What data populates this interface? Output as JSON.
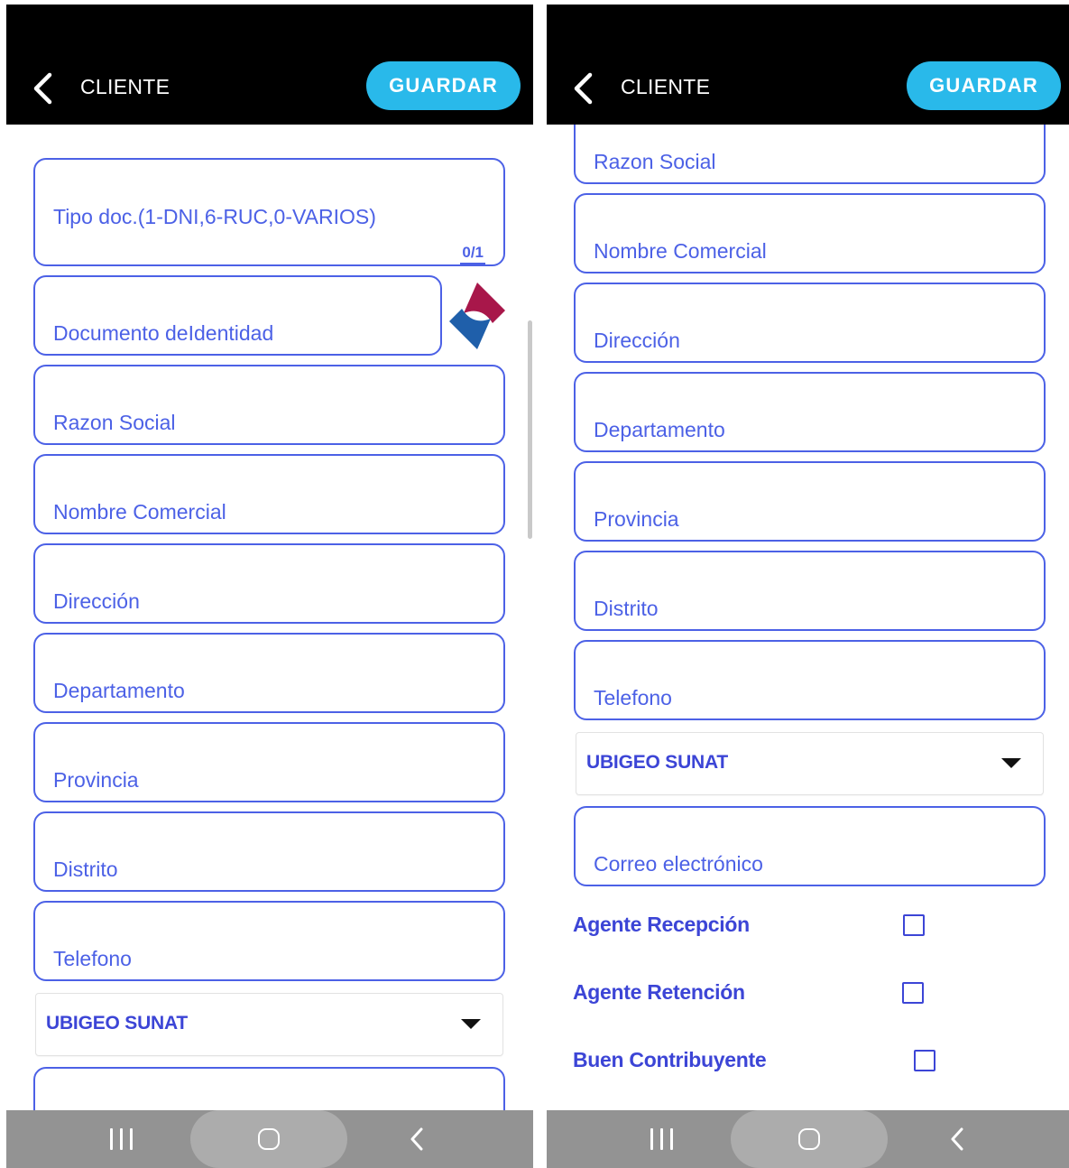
{
  "app": {
    "title": "CLIENTE",
    "save_label": "GUARDAR",
    "icons": {
      "back": "chevron-left-icon",
      "logo": "sunat-logo-icon"
    }
  },
  "colors": {
    "topbar": "#000000",
    "accent": "#29b9ea",
    "field_border": "#4c61e6",
    "label": "#4c61e6",
    "bold_label": "#3c45d6",
    "navbar": "#939393"
  },
  "left_screen": {
    "fields": {
      "tipo_doc": {
        "label": "Tipo doc.(1-DNI,6-RUC,0-VARIOS)",
        "value": "",
        "counter": "0/1"
      },
      "documento": {
        "label": "Documento deIdentidad",
        "value": ""
      },
      "razon_social": {
        "label": "Razon Social",
        "value": ""
      },
      "nombre_comercial": {
        "label": "Nombre Comercial",
        "value": ""
      },
      "direccion": {
        "label": "Dirección",
        "value": ""
      },
      "departamento": {
        "label": "Departamento",
        "value": ""
      },
      "provincia": {
        "label": "Provincia",
        "value": ""
      },
      "distrito": {
        "label": "Distrito",
        "value": ""
      },
      "telefono": {
        "label": "Telefono",
        "value": ""
      }
    },
    "ubigeo": {
      "value": "UBIGEO SUNAT"
    }
  },
  "right_screen": {
    "fields": {
      "razon_social": {
        "label": "Razon Social",
        "value": ""
      },
      "nombre_comercial": {
        "label": "Nombre Comercial",
        "value": ""
      },
      "direccion": {
        "label": "Dirección",
        "value": ""
      },
      "departamento": {
        "label": "Departamento",
        "value": ""
      },
      "provincia": {
        "label": "Provincia",
        "value": ""
      },
      "distrito": {
        "label": "Distrito",
        "value": ""
      },
      "telefono": {
        "label": "Telefono",
        "value": ""
      },
      "correo": {
        "label": "Correo electrónico",
        "value": ""
      }
    },
    "ubigeo": {
      "value": "UBIGEO SUNAT"
    },
    "checkboxes": {
      "agente_recepcion": {
        "label": "Agente Recepción",
        "checked": false
      },
      "agente_retencion": {
        "label": "Agente Retención",
        "checked": false
      },
      "buen_contribuyente": {
        "label": "Buen Contribuyente",
        "checked": false
      }
    }
  },
  "system_nav": {
    "recents": "recents-icon",
    "home": "home-icon",
    "back": "back-icon"
  }
}
